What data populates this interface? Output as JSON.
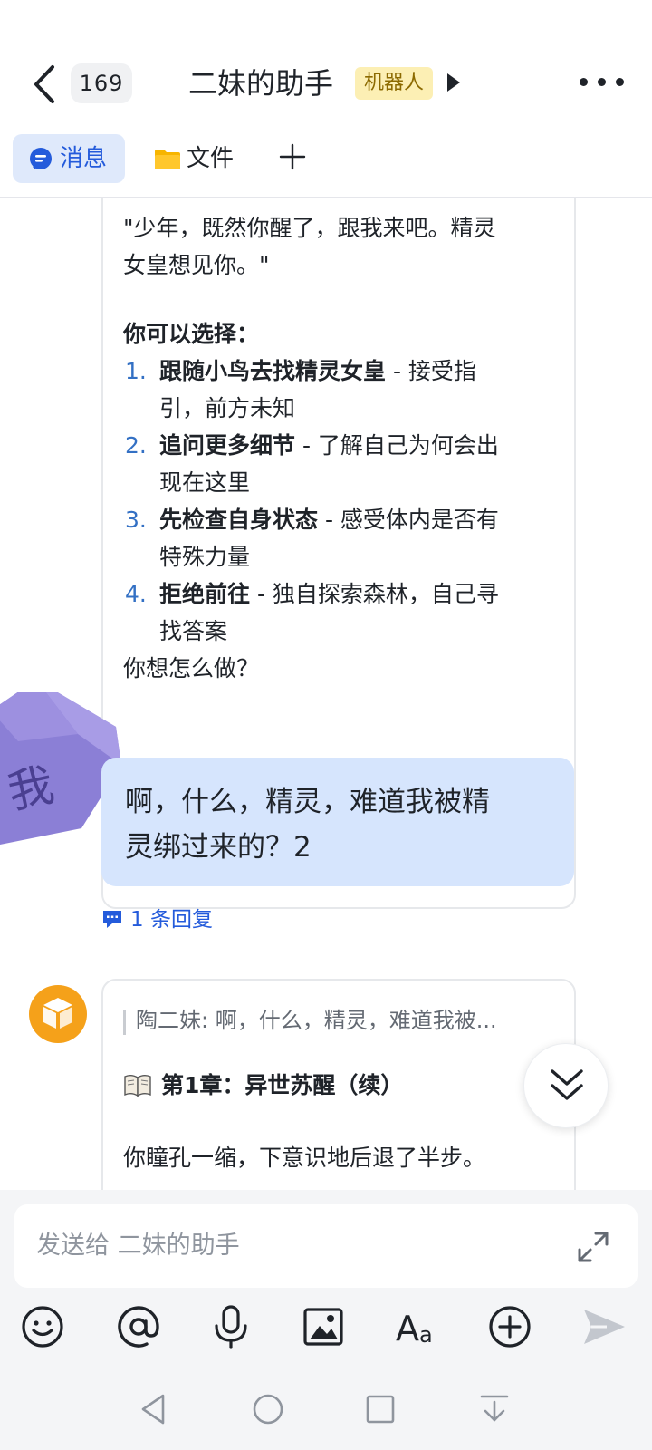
{
  "header": {
    "unread_count": "169",
    "title": "二妹的助手",
    "bot_badge": "机器人"
  },
  "tabs": {
    "messages": "消息",
    "files": "文件"
  },
  "card1": {
    "quote_line1": "\"少年，既然你醒了，跟我来吧。精灵",
    "quote_line2": "女皇想见你。\"",
    "choices_heading": "你可以选择：",
    "options": [
      {
        "num": "1.",
        "title": "跟随小鸟去找精灵女皇",
        "desc1": " - 接受指",
        "desc2": "引，前方未知"
      },
      {
        "num": "2.",
        "title": "追问更多细节",
        "desc1": " - 了解自己为何会出",
        "desc2": "现在这里"
      },
      {
        "num": "3.",
        "title": "先检查自身状态",
        "desc1": " - 感受体内是否有",
        "desc2": "特殊力量"
      },
      {
        "num": "4.",
        "title": "拒绝前往",
        "desc1": " - 独自探索森林，自己寻",
        "desc2": "找答案"
      }
    ],
    "question": "你想怎么做？"
  },
  "my_message": {
    "avatar_text": "我",
    "text_line1": "啊，什么，精灵，难道我被精",
    "text_line2": "灵绑过来的？2",
    "reply_count": "1 条回复"
  },
  "card2": {
    "quote": "陶二妹: 啊，什么，精灵，难道我被...",
    "chapter_title": "第1章：异世苏醒（续）",
    "body": "你瞳孔一缩，下意识地后退了半步。"
  },
  "input": {
    "placeholder": "发送给 二妹的助手"
  },
  "toolbar_icons": [
    "emoji-icon",
    "mention-icon",
    "microphone-icon",
    "image-icon",
    "font-icon",
    "add-circle-icon",
    "send-icon"
  ],
  "colors": {
    "accent": "#245bdb",
    "my_bubble": "#d6e5fd",
    "bot_avatar": "#f5a11a",
    "my_avatar": "#8b7fd6",
    "badge_bg": "#fcefb4"
  }
}
